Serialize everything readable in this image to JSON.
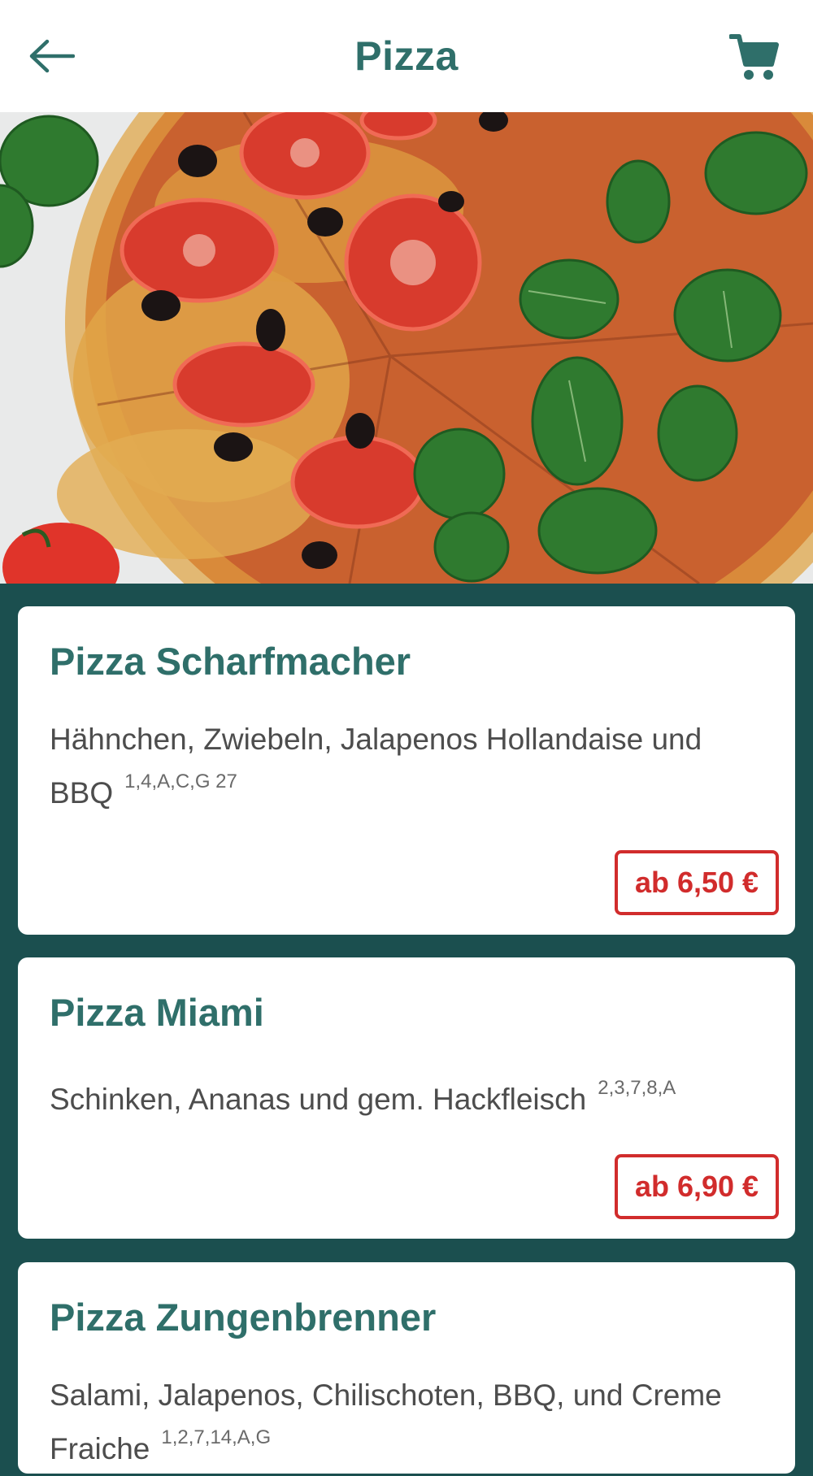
{
  "header": {
    "title": "Pizza",
    "back_icon": "arrow-left-icon",
    "cart_icon": "shopping-cart-icon",
    "accent_color": "#2f6f6a"
  },
  "hero": {
    "image": "pizza-photo"
  },
  "items": [
    {
      "name": "Pizza Scharfmacher",
      "description": "Hähnchen, Zwiebeln, Jalapenos Hollandaise und BBQ",
      "allergens": "1,4,A,C,G 27",
      "price": "ab 6,50 €"
    },
    {
      "name": "Pizza Miami",
      "description": "Schinken, Ananas und gem. Hackfleisch",
      "allergens": "2,3,7,8,A",
      "price": "ab 6,90 €"
    },
    {
      "name": "Pizza Zungenbrenner",
      "description": "Salami, Jalapenos, Chilischoten, BBQ, und Creme Fraiche",
      "allergens": "1,2,7,14,A,G"
    }
  ],
  "colors": {
    "background": "#1b4f4f",
    "price_red": "#d12c2c",
    "text_gray": "#4d4d4d"
  }
}
